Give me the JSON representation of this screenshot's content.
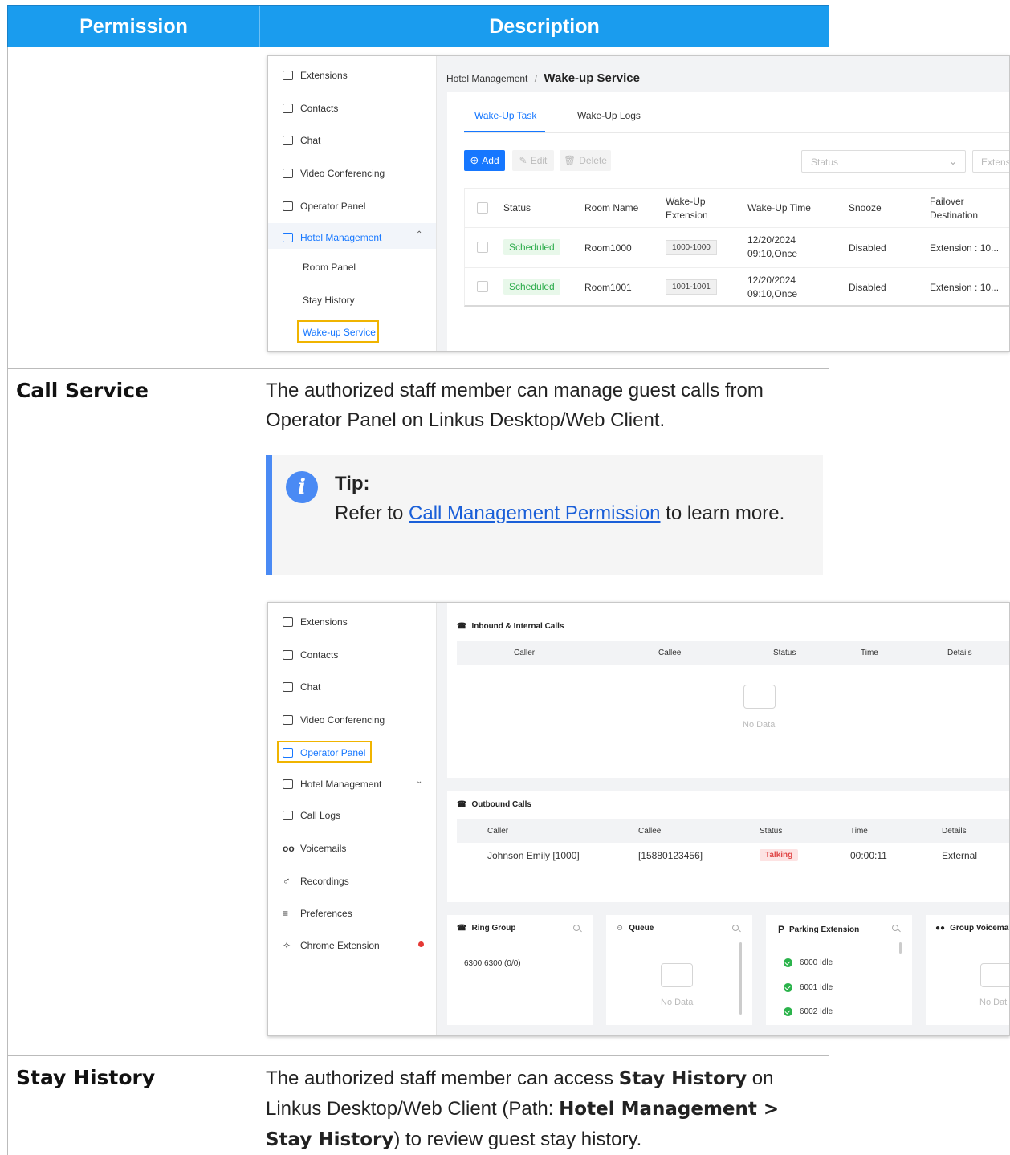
{
  "table": {
    "headers": [
      "Permission",
      "Description"
    ],
    "rows": [
      {
        "permission": "",
        "description": ""
      },
      {
        "permission": "Call Service",
        "description": "The authorized staff member can manage guest calls from Operator Panel on Linkus Desktop/Web Client.",
        "tip": {
          "title": "Tip:",
          "prefix": "Refer to ",
          "link": "Call Management Permission",
          "suffix": " to learn more."
        }
      },
      {
        "permission": "Stay History",
        "desc_parts": [
          "The authorized staff member can access ",
          "Stay History",
          " on Linkus Desktop/Web Client (Path: ",
          "Hotel Management >",
          " ",
          "Stay History",
          ") to review guest stay history."
        ]
      }
    ]
  },
  "shot1": {
    "nav": [
      "Extensions",
      "Contacts",
      "Chat",
      "Video Conferencing",
      "Operator Panel",
      "Hotel Management"
    ],
    "sub": [
      "Room Panel",
      "Stay History",
      "Wake-up Service"
    ],
    "breadcrumb_parent": "Hotel Management",
    "breadcrumb_sep": "/",
    "breadcrumb_current": "Wake-up Service",
    "tabs": [
      "Wake-Up Task",
      "Wake-Up Logs"
    ],
    "buttons": {
      "add": "Add",
      "edit": "Edit",
      "delete": "Delete"
    },
    "filter_status": "Status",
    "filter_ext": "Extensi",
    "columns": [
      "Status",
      "Room Name",
      "Wake-Up\nExtension",
      "Wake-Up Time",
      "Snooze",
      "Failover\nDestination"
    ],
    "rows": [
      {
        "status": "Scheduled",
        "room": "Room1000",
        "ext": "1000-1000",
        "time": "12/20/2024\n09:10,Once",
        "snooze": "Disabled",
        "failover": "Extension : 10..."
      },
      {
        "status": "Scheduled",
        "room": "Room1001",
        "ext": "1001-1001",
        "time": "12/20/2024\n09:10,Once",
        "snooze": "Disabled",
        "failover": "Extension : 10..."
      }
    ],
    "colors": {
      "accent": "#1677ff",
      "scheduled_bg": "#e8f8ea",
      "scheduled_fg": "#2bab4a",
      "highlight": "#f0b400"
    }
  },
  "shot2": {
    "nav": [
      "Extensions",
      "Contacts",
      "Chat",
      "Video Conferencing",
      "Operator Panel",
      "Hotel Management",
      "Call Logs",
      "Voicemails",
      "Recordings",
      "Preferences",
      "Chrome Extension"
    ],
    "inbound_title": "Inbound & Internal Calls",
    "inbound_cols": [
      "Caller",
      "Callee",
      "Status",
      "Time",
      "Details"
    ],
    "no_data": "No Data",
    "outbound_title": "Outbound Calls",
    "outbound_cols": [
      "Caller",
      "Callee",
      "Status",
      "Time",
      "Details"
    ],
    "outbound_row": {
      "caller": "Johnson Emily [1000]",
      "callee": "[15880123456]",
      "status": "Talking",
      "time": "00:00:11",
      "details": "External"
    },
    "cards": {
      "ring_group": {
        "title": "Ring Group",
        "item": "6300 6300 (0/0)"
      },
      "queue": {
        "title": "Queue"
      },
      "parking": {
        "title": "Parking Extension",
        "prefix": "P",
        "items": [
          "6000 Idle",
          "6001 Idle",
          "6002 Idle"
        ]
      },
      "group_vm": {
        "title": "Group Voicemail",
        "nodata": "No Dat"
      }
    },
    "colors": {
      "talking_bg": "#fde3e3",
      "talking_fg": "#e04848",
      "red_dot": "#e53935"
    }
  }
}
